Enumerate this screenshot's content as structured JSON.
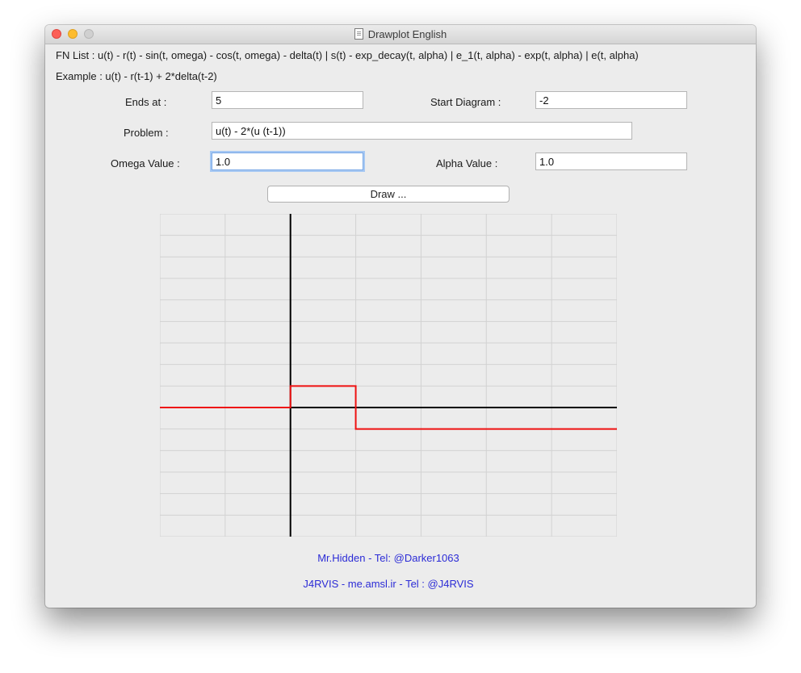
{
  "window": {
    "title": "Drawplot English"
  },
  "info": {
    "fn_list": "FN List : u(t) - r(t) - sin(t, omega) - cos(t, omega) - delta(t) | s(t) - exp_decay(t, alpha) | e_1(t, alpha) - exp(t, alpha) | e(t, alpha)",
    "example": "Example : u(t) - r(t-1) + 2*delta(t-2)"
  },
  "form": {
    "ends_label": "Ends at :",
    "ends_value": "5",
    "start_label": "Start Diagram :",
    "start_value": "-2",
    "problem_label": "Problem :",
    "problem_value": "u(t) - 2*(u (t-1))",
    "omega_label": "Omega Value :",
    "omega_value": "1.0",
    "alpha_label": "Alpha Value :",
    "alpha_value": "1.0",
    "draw_label": "Draw ..."
  },
  "chart_data": {
    "type": "line",
    "x": [
      -2,
      0,
      0,
      1,
      1,
      5
    ],
    "y": [
      0,
      0,
      1,
      1,
      -1,
      -1
    ],
    "series": [
      {
        "name": "",
        "color": "#ee1111",
        "x": [
          -2,
          0,
          0,
          1,
          1,
          5
        ],
        "y": [
          0,
          0,
          1,
          1,
          -1,
          -1
        ]
      }
    ],
    "xlim": [
      -2,
      5
    ],
    "ylim": [
      -6,
      9
    ],
    "grid": true,
    "axis_color": "#000000",
    "title": "",
    "xlabel": "",
    "ylabel": ""
  },
  "credits": {
    "line1": "Mr.Hidden - Tel: @Darker1063",
    "line2": "J4RVIS - me.amsl.ir - Tel : @J4RVIS"
  }
}
